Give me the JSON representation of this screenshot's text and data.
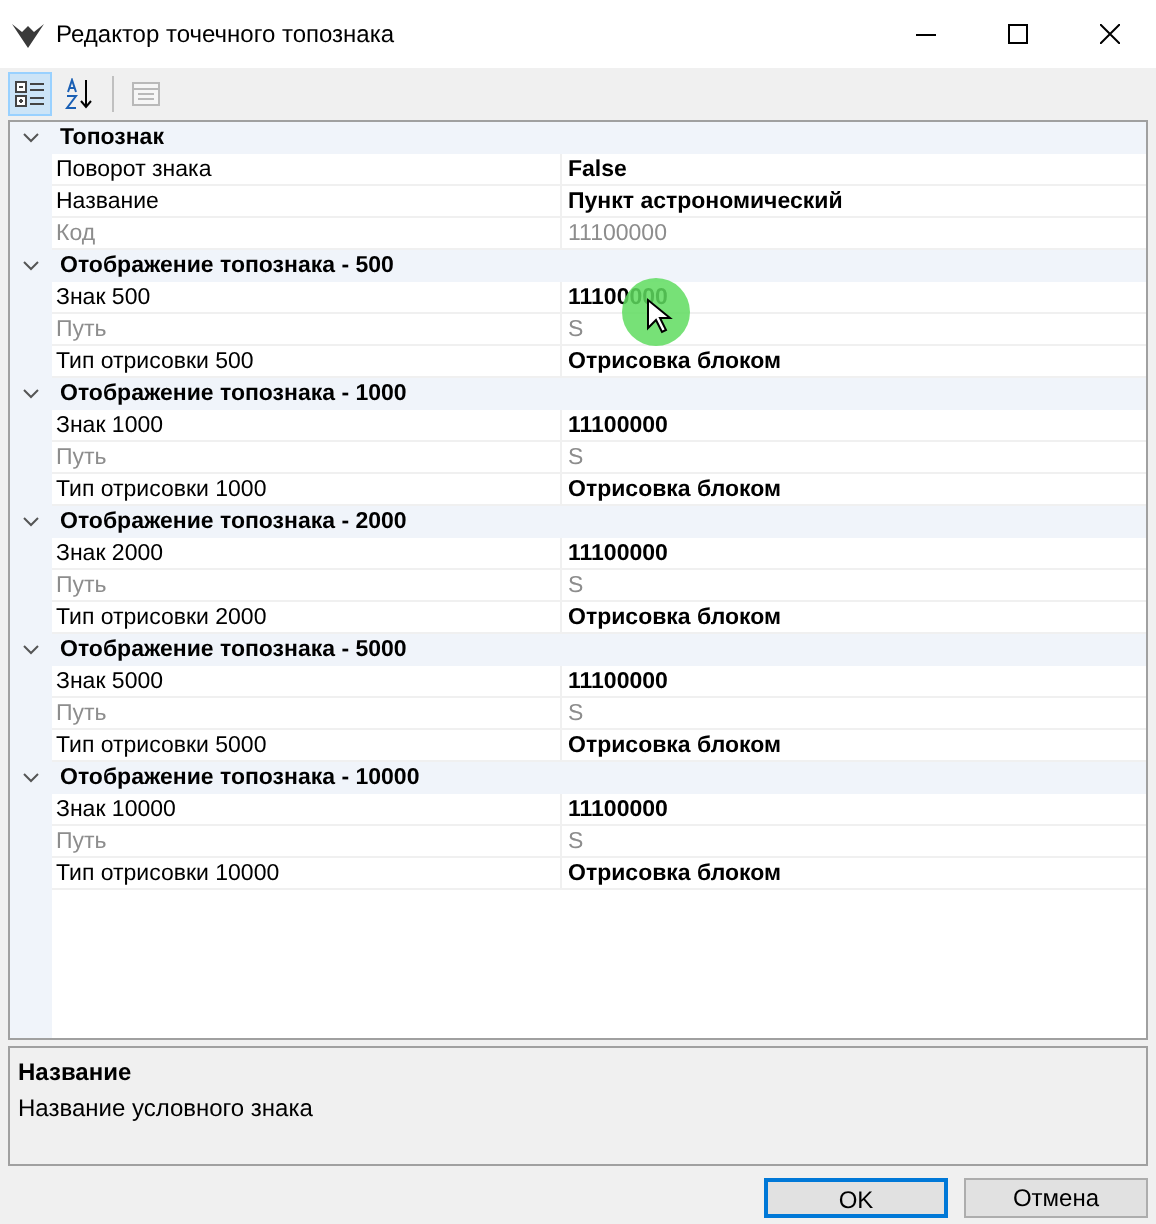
{
  "window": {
    "title": "Редактор точечного топознака"
  },
  "toolbar": [
    {
      "kind": "categorized",
      "selected": true,
      "disabled": false
    },
    {
      "kind": "alphabetical",
      "selected": false,
      "disabled": false
    },
    {
      "kind": "pages",
      "selected": false,
      "disabled": true
    }
  ],
  "categories": [
    {
      "name": "Топознак",
      "expanded": true,
      "properties": [
        {
          "name": "Поворот знака",
          "value": "False",
          "readonly": false,
          "modified": true
        },
        {
          "name": "Название",
          "value": "Пункт астрономический",
          "readonly": false,
          "modified": true
        },
        {
          "name": "Код",
          "value": "11100000",
          "readonly": true,
          "modified": false
        }
      ]
    },
    {
      "name": "Отображение топознака -  500",
      "expanded": true,
      "properties": [
        {
          "name": "Знак 500",
          "value": "11100000",
          "readonly": false,
          "modified": true
        },
        {
          "name": "Путь",
          "value": "S",
          "readonly": true,
          "modified": false
        },
        {
          "name": "Тип отрисовки 500",
          "value": "Отрисовка блоком",
          "readonly": false,
          "modified": true
        }
      ]
    },
    {
      "name": "Отображение топознака - 1000",
      "expanded": true,
      "properties": [
        {
          "name": "Знак 1000",
          "value": "11100000",
          "readonly": false,
          "modified": true
        },
        {
          "name": "Путь",
          "value": "S",
          "readonly": true,
          "modified": false
        },
        {
          "name": "Тип отрисовки 1000",
          "value": "Отрисовка блоком",
          "readonly": false,
          "modified": true
        }
      ]
    },
    {
      "name": "Отображение топознака - 2000",
      "expanded": true,
      "properties": [
        {
          "name": "Знак 2000",
          "value": "11100000",
          "readonly": false,
          "modified": true
        },
        {
          "name": "Путь",
          "value": "S",
          "readonly": true,
          "modified": false
        },
        {
          "name": "Тип отрисовки 2000",
          "value": "Отрисовка блоком",
          "readonly": false,
          "modified": true
        }
      ]
    },
    {
      "name": "Отображение топознака - 5000",
      "expanded": true,
      "properties": [
        {
          "name": "Знак 5000",
          "value": "11100000",
          "readonly": false,
          "modified": true
        },
        {
          "name": "Путь",
          "value": "S",
          "readonly": true,
          "modified": false
        },
        {
          "name": "Тип отрисовки 5000",
          "value": "Отрисовка блоком",
          "readonly": false,
          "modified": true
        }
      ]
    },
    {
      "name": "Отображение топознака - 10000",
      "expanded": true,
      "properties": [
        {
          "name": "Знак 10000",
          "value": "11100000",
          "readonly": false,
          "modified": true
        },
        {
          "name": "Путь",
          "value": "S",
          "readonly": true,
          "modified": false
        },
        {
          "name": "Тип отрисовки 10000",
          "value": "Отрисовка блоком",
          "readonly": false,
          "modified": true
        }
      ]
    }
  ],
  "description": {
    "title": "Название",
    "text": "Название условного знака"
  },
  "buttons": [
    {
      "label": "OK",
      "default": true
    },
    {
      "label": "Отмена",
      "default": false
    }
  ]
}
